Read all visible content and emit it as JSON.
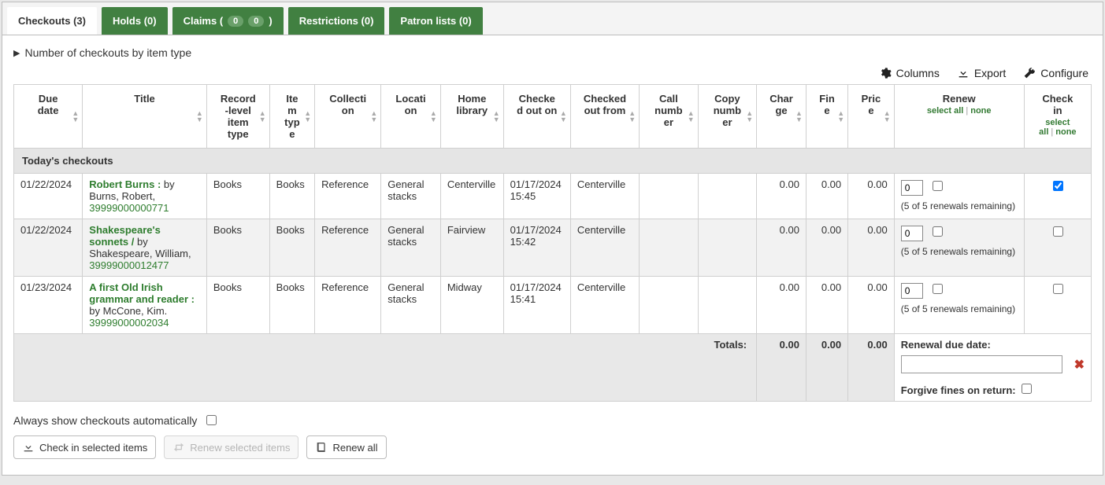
{
  "tabs": {
    "checkouts": "Checkouts (3)",
    "holds": "Holds (0)",
    "claims_label": "Claims (",
    "claims_close": ")",
    "claims_badge1": "0",
    "claims_badge2": "0",
    "restrictions": "Restrictions (0)",
    "patron_lists": "Patron lists (0)"
  },
  "accordion": {
    "label": "Number of checkouts by item type"
  },
  "tools": {
    "columns": "Columns",
    "export": "Export",
    "configure": "Configure"
  },
  "columns": {
    "due_date": "Due date",
    "title": "Title",
    "record_level_item_type": "Record-level item type",
    "item_type": "Item type",
    "collection": "Collection",
    "location": "Location",
    "home_library": "Home library",
    "checked_out_on": "Checked out on",
    "checked_out_from": "Checked out from",
    "call_number": "Call number",
    "copy_number": "Copy number",
    "charge": "Charge",
    "fine": "Fine",
    "price": "Price",
    "renew": "Renew",
    "check_in": "Check in",
    "select_all": "select all",
    "none": "none"
  },
  "group_header": "Today's checkouts",
  "rows": [
    {
      "due": "01/22/2024",
      "title_link": "Robert Burns :",
      "byline": " by Burns, Robert,",
      "barcode": "39999000000771",
      "rlit": "Books",
      "itype": "Books",
      "collection": "Reference",
      "location": "General stacks",
      "home": "Centerville",
      "co_on": "01/17/2024 15:45",
      "co_from": "Centerville",
      "call": "",
      "copy": "",
      "charge": "0.00",
      "fine": "0.00",
      "price": "0.00",
      "renew_val": "0",
      "renew_hint": "(5 of 5 renewals remaining)",
      "checkin_checked": true
    },
    {
      "due": "01/22/2024",
      "title_link": "Shakespeare's sonnets /",
      "byline": " by Shakespeare, William,",
      "barcode": "39999000012477",
      "rlit": "Books",
      "itype": "Books",
      "collection": "Reference",
      "location": "General stacks",
      "home": "Fairview",
      "co_on": "01/17/2024 15:42",
      "co_from": "Centerville",
      "call": "",
      "copy": "",
      "charge": "0.00",
      "fine": "0.00",
      "price": "0.00",
      "renew_val": "0",
      "renew_hint": "(5 of 5 renewals remaining)",
      "checkin_checked": false
    },
    {
      "due": "01/23/2024",
      "title_link": "A first Old Irish grammar and reader :",
      "byline": " by McCone, Kim.",
      "barcode": "39999000002034",
      "rlit": "Books",
      "itype": "Books",
      "collection": "Reference",
      "location": "General stacks",
      "home": "Midway",
      "co_on": "01/17/2024 15:41",
      "co_from": "Centerville",
      "call": "",
      "copy": "",
      "charge": "0.00",
      "fine": "0.00",
      "price": "0.00",
      "renew_val": "0",
      "renew_hint": "(5 of 5 renewals remaining)",
      "checkin_checked": false
    }
  ],
  "totals": {
    "label": "Totals:",
    "charge": "0.00",
    "fine": "0.00",
    "price": "0.00"
  },
  "renewal_box": {
    "label": "Renewal due date:",
    "forgive_label": "Forgive fines on return:"
  },
  "footer": {
    "always_show": "Always show checkouts automatically",
    "check_in": "Check in selected items",
    "renew_selected": "Renew selected items",
    "renew_all": "Renew all"
  }
}
